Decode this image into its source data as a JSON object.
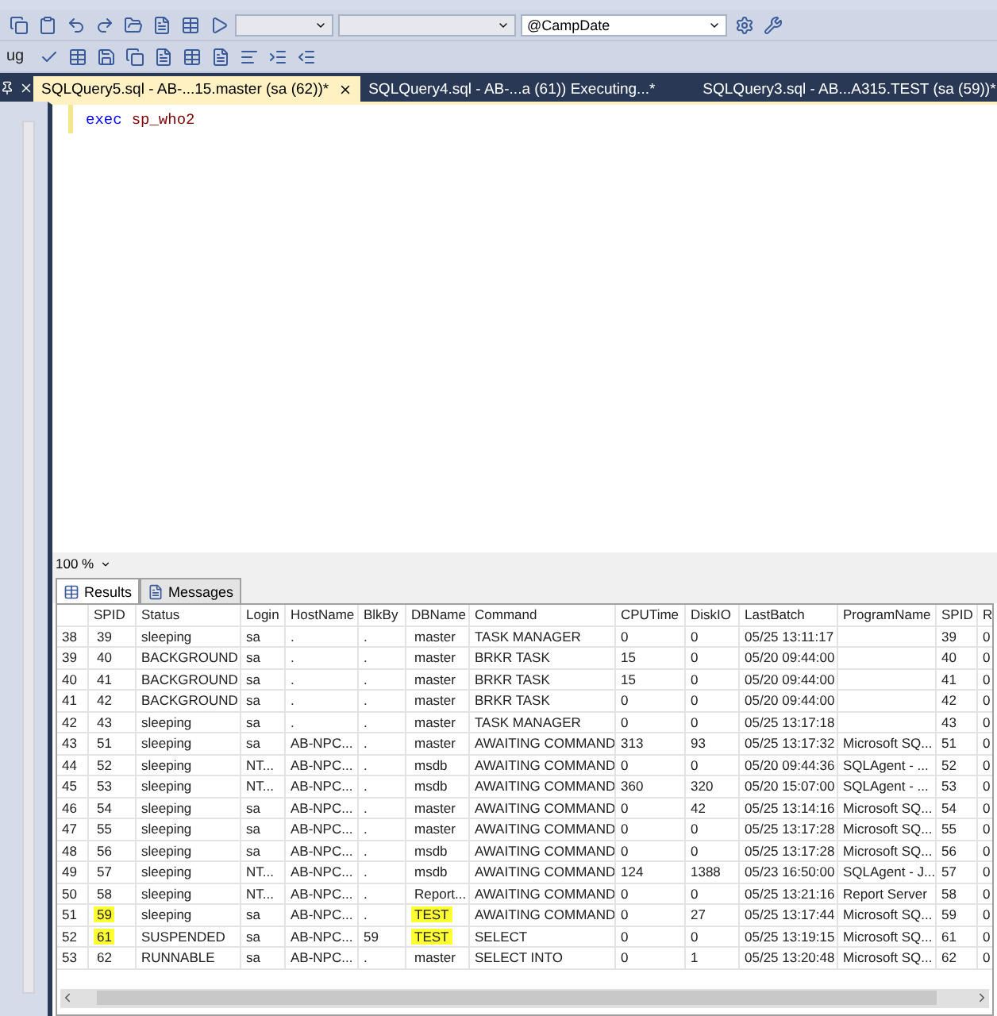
{
  "toolbar": {
    "combos": [
      {
        "disabled": true
      },
      {
        "disabled": true
      },
      {
        "value": "@CampDate",
        "disabled": false
      }
    ],
    "menu_fragment": "ug"
  },
  "tabs": [
    {
      "label": "SQLQuery5.sql - AB-...15.master (sa (62))*",
      "selected": true
    },
    {
      "label": "SQLQuery4.sql - AB-...a (61)) Executing...*",
      "selected": false
    },
    {
      "label": "SQLQuery3.sql - AB...A315.TEST (sa (59))*",
      "selected": false
    }
  ],
  "editor": {
    "keyword": "exec",
    "procedure": "sp_who2"
  },
  "zoom": "100 %",
  "result_tabs": [
    {
      "label": "Results",
      "selected": true
    },
    {
      "label": "Messages",
      "selected": false
    }
  ],
  "table": {
    "columns": [
      "",
      "SPID",
      "Status",
      "Login",
      "HostName",
      "BlkBy",
      "DBName",
      "Command",
      "CPUTime",
      "DiskIO",
      "LastBatch",
      "ProgramName",
      "SPID",
      "R"
    ],
    "rows": [
      {
        "cells": [
          "38",
          "39",
          "sleeping",
          "sa",
          ".",
          ".",
          "master",
          "TASK MANAGER",
          "0",
          "0",
          "05/25 13:11:17",
          "",
          "39",
          "0"
        ],
        "spid_highlighted": false,
        "dbname_highlighted": false
      },
      {
        "cells": [
          "39",
          "40",
          "BACKGROUND",
          "sa",
          ".",
          ".",
          "master",
          "BRKR TASK",
          "15",
          "0",
          "05/20 09:44:00",
          "",
          "40",
          "0"
        ],
        "spid_highlighted": false,
        "dbname_highlighted": false
      },
      {
        "cells": [
          "40",
          "41",
          "BACKGROUND",
          "sa",
          ".",
          ".",
          "master",
          "BRKR TASK",
          "15",
          "0",
          "05/20 09:44:00",
          "",
          "41",
          "0"
        ],
        "spid_highlighted": false,
        "dbname_highlighted": false
      },
      {
        "cells": [
          "41",
          "42",
          "BACKGROUND",
          "sa",
          ".",
          ".",
          "master",
          "BRKR TASK",
          "0",
          "0",
          "05/20 09:44:00",
          "",
          "42",
          "0"
        ],
        "spid_highlighted": false,
        "dbname_highlighted": false
      },
      {
        "cells": [
          "42",
          "43",
          "sleeping",
          "sa",
          ".",
          ".",
          "master",
          "TASK MANAGER",
          "0",
          "0",
          "05/25 13:17:18",
          "",
          "43",
          "0"
        ],
        "spid_highlighted": false,
        "dbname_highlighted": false
      },
      {
        "cells": [
          "43",
          "51",
          "sleeping",
          "sa",
          "AB-NPC...",
          ".",
          "master",
          "AWAITING COMMAND",
          "313",
          "93",
          "05/25 13:17:32",
          "Microsoft SQ...",
          "51",
          "0"
        ],
        "spid_highlighted": false,
        "dbname_highlighted": false
      },
      {
        "cells": [
          "44",
          "52",
          "sleeping",
          "NT...",
          "AB-NPC...",
          ".",
          "msdb",
          "AWAITING COMMAND",
          "0",
          "0",
          "05/20 09:44:36",
          "SQLAgent - ...",
          "52",
          "0"
        ],
        "spid_highlighted": false,
        "dbname_highlighted": false
      },
      {
        "cells": [
          "45",
          "53",
          "sleeping",
          "NT...",
          "AB-NPC...",
          ".",
          "msdb",
          "AWAITING COMMAND",
          "360",
          "320",
          "05/20 15:07:00",
          "SQLAgent - ...",
          "53",
          "0"
        ],
        "spid_highlighted": false,
        "dbname_highlighted": false
      },
      {
        "cells": [
          "46",
          "54",
          "sleeping",
          "sa",
          "AB-NPC...",
          ".",
          "master",
          "AWAITING COMMAND",
          "0",
          "42",
          "05/25 13:14:16",
          "Microsoft SQ...",
          "54",
          "0"
        ],
        "spid_highlighted": false,
        "dbname_highlighted": false
      },
      {
        "cells": [
          "47",
          "55",
          "sleeping",
          "sa",
          "AB-NPC...",
          ".",
          "master",
          "AWAITING COMMAND",
          "0",
          "0",
          "05/25 13:17:28",
          "Microsoft SQ...",
          "55",
          "0"
        ],
        "spid_highlighted": false,
        "dbname_highlighted": false
      },
      {
        "cells": [
          "48",
          "56",
          "sleeping",
          "sa",
          "AB-NPC...",
          ".",
          "msdb",
          "AWAITING COMMAND",
          "0",
          "0",
          "05/25 13:17:28",
          "Microsoft SQ...",
          "56",
          "0"
        ],
        "spid_highlighted": false,
        "dbname_highlighted": false
      },
      {
        "cells": [
          "49",
          "57",
          "sleeping",
          "NT...",
          "AB-NPC...",
          ".",
          "msdb",
          "AWAITING COMMAND",
          "124",
          "1388",
          "05/23 16:50:00",
          "SQLAgent - J...",
          "57",
          "0"
        ],
        "spid_highlighted": false,
        "dbname_highlighted": false
      },
      {
        "cells": [
          "50",
          "58",
          "sleeping",
          "NT...",
          "AB-NPC...",
          ".",
          "Report...",
          "AWAITING COMMAND",
          "0",
          "0",
          "05/25 13:21:16",
          "Report Server",
          "58",
          "0"
        ],
        "spid_highlighted": false,
        "dbname_highlighted": false
      },
      {
        "cells": [
          "51",
          "59",
          "sleeping",
          "sa",
          "AB-NPC...",
          ".",
          "TEST",
          "AWAITING COMMAND",
          "0",
          "27",
          "05/25 13:17:44",
          "Microsoft SQ...",
          "59",
          "0"
        ],
        "spid_highlighted": true,
        "dbname_highlighted": true
      },
      {
        "cells": [
          "52",
          "61",
          "SUSPENDED",
          "sa",
          "AB-NPC...",
          "59",
          "TEST",
          "SELECT",
          "0",
          "0",
          "05/25 13:19:15",
          "Microsoft SQ...",
          "61",
          "0"
        ],
        "spid_highlighted": true,
        "dbname_highlighted": true
      },
      {
        "cells": [
          "53",
          "62",
          "RUNNABLE",
          "sa",
          "AB-NPC...",
          ".",
          "master",
          "SELECT INTO",
          "0",
          "1",
          "05/25 13:20:48",
          "Microsoft SQ...",
          "62",
          "0"
        ],
        "spid_highlighted": false,
        "dbname_highlighted": false
      }
    ]
  }
}
